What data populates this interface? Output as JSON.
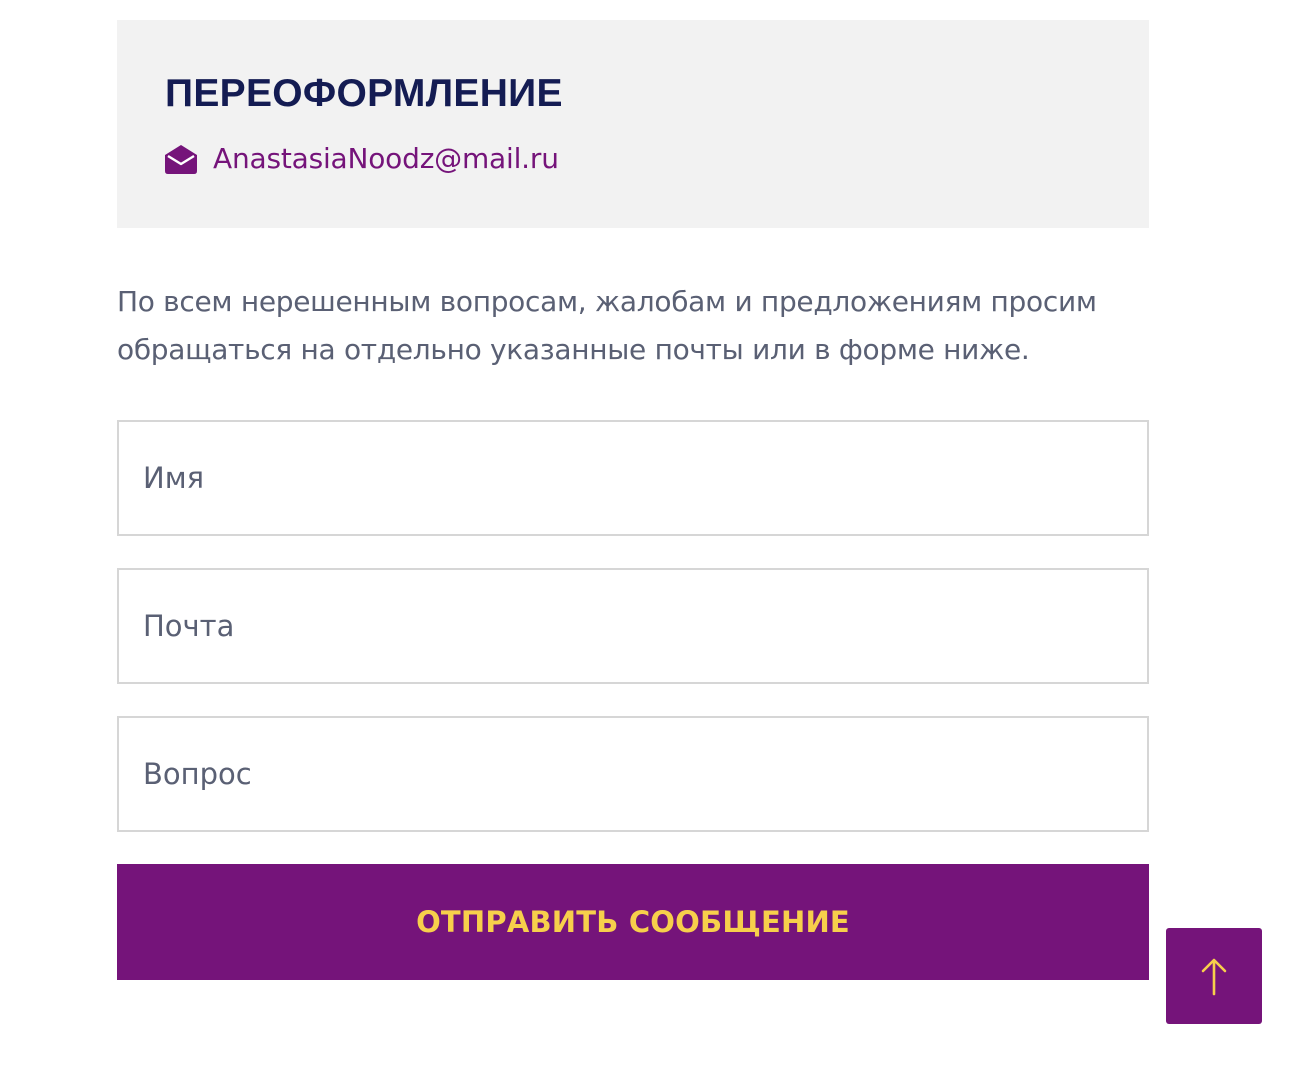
{
  "contact_card": {
    "title": "ПЕРЕОФОРМЛЕНИЕ",
    "email": "AnastasiaNoodz@mail.ru",
    "email_icon": "envelope-open-icon"
  },
  "intro": {
    "text": "По всем нерешенным вопросам, жалобам и предложениям просим обращаться на отдельно указанные почты или в форме ниже."
  },
  "form": {
    "name_placeholder": "Имя",
    "email_placeholder": "Почта",
    "question_placeholder": "Вопрос",
    "submit_label": "ОТПРАВИТЬ СООБЩЕНИЕ"
  },
  "scroll_top": {
    "icon": "arrow-up-icon"
  },
  "colors": {
    "accent": "#75147a",
    "button_text": "#f7cf4b",
    "heading": "#141c53",
    "body_text": "#5a6074",
    "card_background": "#f2f2f2",
    "field_border": "#d6d6d6"
  }
}
